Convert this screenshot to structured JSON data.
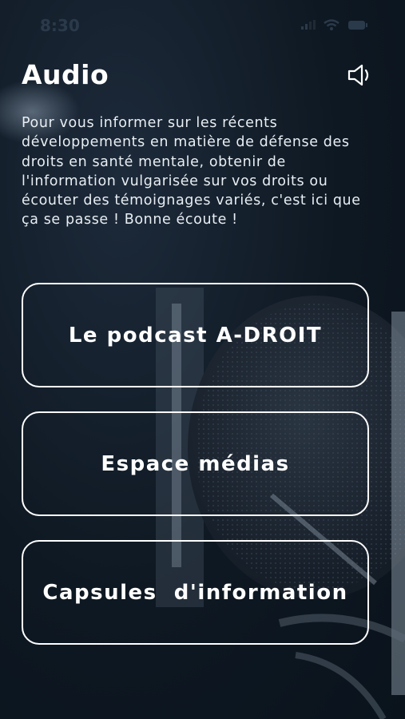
{
  "status_bar": {
    "time": "8:30"
  },
  "header": {
    "title": "Audio",
    "speaker_icon": "speaker-icon"
  },
  "intro_text": "Pour vous informer sur les récents développements en matière de défense des droits en santé mentale, obtenir de l'information vulgarisée sur vos droits ou écouter des témoignages variés, c'est ici que ça se passe ! Bonne écoute !",
  "menu": [
    {
      "label": "Le podcast A-DROIT"
    },
    {
      "label": "Espace médias"
    },
    {
      "label": "Capsules  d'information"
    }
  ],
  "colors": {
    "background": "#0e1822",
    "text": "#ffffff",
    "button_border": "#ffffff"
  }
}
